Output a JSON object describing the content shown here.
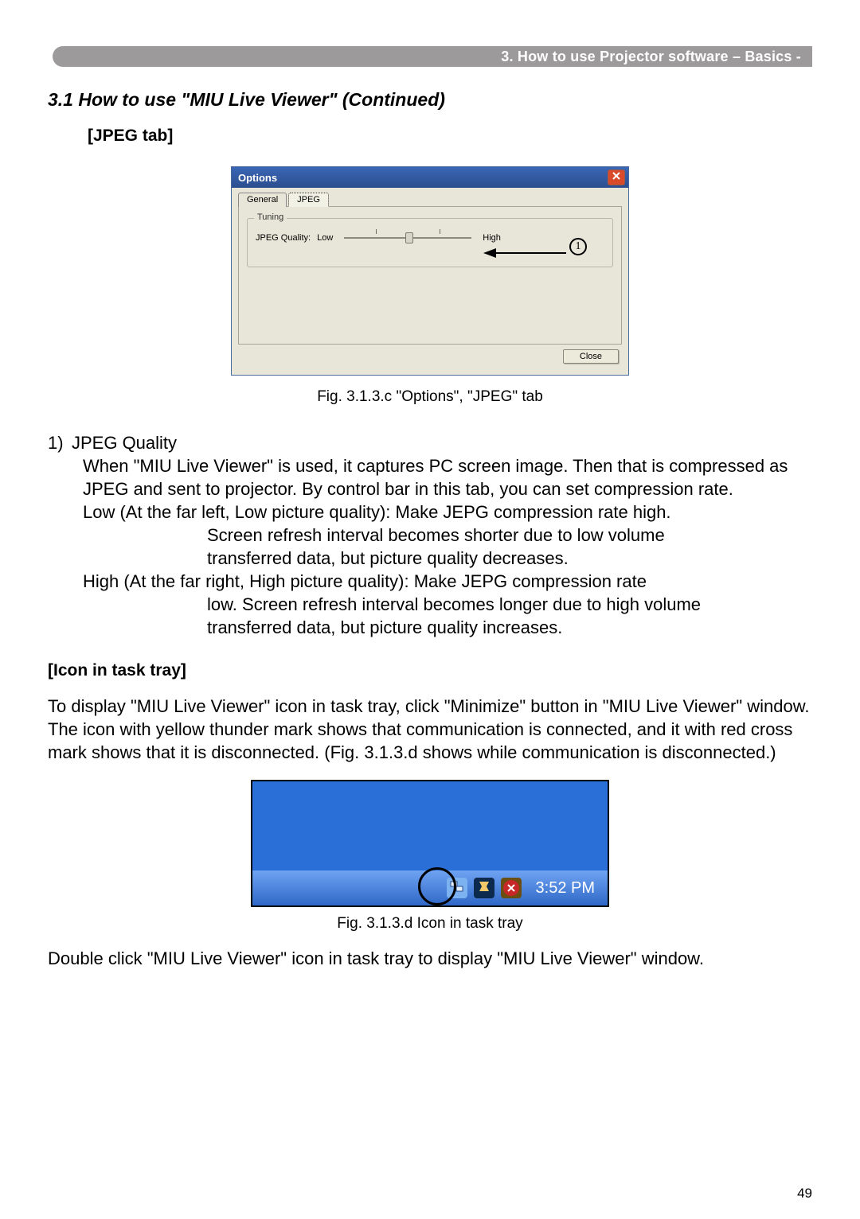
{
  "header": {
    "text": "3. How to use Projector software – Basics -"
  },
  "section_title": "3.1 How to use \"MIU Live Viewer\" (Continued)",
  "jpeg_tab_heading": "[JPEG tab]",
  "dialog": {
    "title": "Options",
    "tab_general": "General",
    "tab_jpeg": "JPEG",
    "fieldset_legend": "Tuning",
    "quality_label": "JPEG Quality:",
    "low": "Low",
    "high": "High",
    "close": "Close",
    "callout_num": "1"
  },
  "fig1_caption": "Fig. 3.1.3.c \"Options\", \"JPEG\" tab",
  "item1": {
    "num": "1)",
    "title": "JPEG Quality",
    "p1": "When \"MIU Live Viewer\" is used, it captures PC screen image. Then that is compressed as JPEG and sent to projector. By control bar in this tab, you can set compression rate.",
    "low_line": "Low (At the far left, Low picture quality): Make JEPG compression rate high.",
    "low_cont1": "Screen refresh interval becomes shorter due to low volume",
    "low_cont2": "transferred data, but picture quality decreases.",
    "high_line": "High (At the far right, High picture quality): Make JEPG compression rate",
    "high_cont1": "low. Screen refresh interval becomes longer due to high volume",
    "high_cont2": "transferred data, but picture quality increases."
  },
  "tray_heading": "[Icon in task tray]",
  "tray_para": "To display \"MIU Live Viewer\" icon in task tray, click \"Minimize\" button in \"MIU Live Viewer\" window. The icon with yellow thunder mark shows that communication is connected, and it with red cross mark shows that it is disconnected. (Fig. 3.1.3.d shows while communication is disconnected.)",
  "clock": "3:52 PM",
  "fig2_caption": "Fig. 3.1.3.d Icon in task tray",
  "final_para": "Double click \"MIU Live Viewer\" icon in task tray to display \"MIU Live Viewer\" window.",
  "page_number": "49"
}
